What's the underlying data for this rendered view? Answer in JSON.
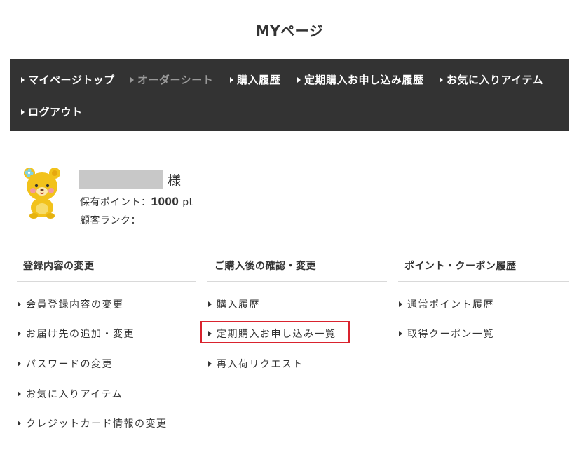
{
  "page": {
    "title": "MYページ"
  },
  "nav": {
    "items": [
      {
        "label": "マイページトップ",
        "active": true
      },
      {
        "label": "オーダーシート",
        "active": false
      },
      {
        "label": "購入履歴",
        "active": true
      },
      {
        "label": "定期購入お申し込み履歴",
        "active": true
      },
      {
        "label": "お気に入りアイテム",
        "active": true
      },
      {
        "label": "ログアウト",
        "active": true
      }
    ]
  },
  "profile": {
    "honorific": "様",
    "points_label": "保有ポイント：",
    "points_value": "1000",
    "points_unit": "pt",
    "rank_label": "顧客ランク："
  },
  "columns": [
    {
      "heading": "登録内容の変更",
      "links": [
        "会員登録内容の変更",
        "お届け先の追加・変更",
        "パスワードの変更",
        "お気に入りアイテム",
        "クレジットカード情報の変更"
      ]
    },
    {
      "heading": "ご購入後の確認・変更",
      "links": [
        "購入履歴",
        "定期購入お申し込み一覧",
        "再入荷リクエスト"
      ]
    },
    {
      "heading": "ポイント・クーポン履歴",
      "links": [
        "通常ポイント履歴",
        "取得クーポン一覧"
      ]
    }
  ],
  "colors": {
    "nav_background": "#333333",
    "nav_text": "#ffffff",
    "nav_muted_text": "#9a9a9a",
    "highlight_border": "#d9232e"
  }
}
